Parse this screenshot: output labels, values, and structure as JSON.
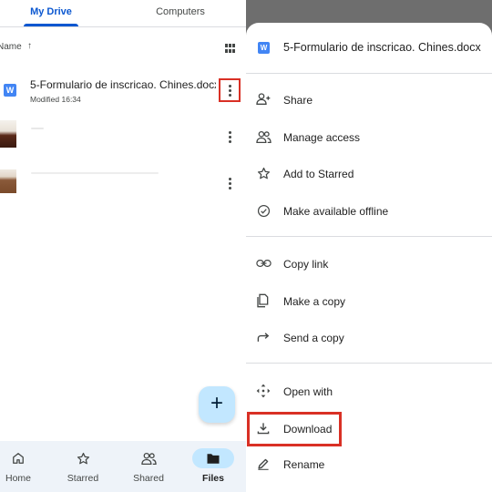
{
  "tabs": [
    {
      "label": "My Drive",
      "active": true
    },
    {
      "label": "Computers",
      "active": false
    }
  ],
  "sort": {
    "label": "Name",
    "arrow": "↑"
  },
  "files": [
    {
      "name": "5-Formulario de inscricao. Chines.docx",
      "meta": "Modified 16:34",
      "icon": "word-doc-icon",
      "icon_letter": "W"
    },
    {
      "name": "",
      "meta": "",
      "icon": "image-thumbnail"
    },
    {
      "name": "",
      "meta": "",
      "icon": "image-thumbnail"
    }
  ],
  "fab": {
    "symbol": "+"
  },
  "bottom_nav": [
    {
      "label": "Home",
      "icon": "home-icon",
      "active": false
    },
    {
      "label": "Starred",
      "icon": "star-icon",
      "active": false
    },
    {
      "label": "Shared",
      "icon": "people-icon",
      "active": false
    },
    {
      "label": "Files",
      "icon": "folder-icon",
      "active": true
    }
  ],
  "sheet": {
    "title": "5-Formulario de inscricao. Chines.docx",
    "icon_letter": "W",
    "groups": [
      [
        {
          "label": "Share",
          "icon": "person-add-icon"
        },
        {
          "label": "Manage access",
          "icon": "manage-access-icon"
        },
        {
          "label": "Add to Starred",
          "icon": "star-outline-icon"
        },
        {
          "label": "Make available offline",
          "icon": "offline-check-icon"
        }
      ],
      [
        {
          "label": "Copy link",
          "icon": "link-icon"
        },
        {
          "label": "Make a copy",
          "icon": "copy-icon"
        },
        {
          "label": "Send a copy",
          "icon": "forward-arrow-icon"
        }
      ],
      [
        {
          "label": "Open with",
          "icon": "open-with-icon"
        },
        {
          "label": "Download",
          "icon": "download-icon",
          "highlighted": true
        },
        {
          "label": "Rename",
          "icon": "edit-icon"
        }
      ]
    ]
  },
  "colors": {
    "accent": "#0b57d0",
    "highlight_box": "#d93025",
    "fab_bg": "#c2e7ff",
    "nav_bg": "#eef3f9",
    "scrim": "#6e6e6e",
    "word_blue": "#4285f4"
  }
}
